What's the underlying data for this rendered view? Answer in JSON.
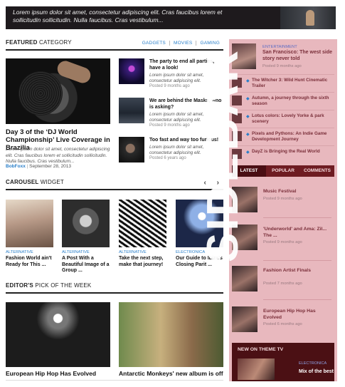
{
  "banner": {
    "text": "Lorem ipsum dolor sit amet, consectetur adipiscing elit. Cras faucibus lorem et sollicitudin sollicitudin. Nulla faucibus. Cras vestibulum..."
  },
  "featured": {
    "heading_bold": "FEATURED",
    "heading_light": "CATEGORY",
    "tabs": [
      "GADGETS",
      "MOVIES",
      "GAMING"
    ],
    "main": {
      "title": "Day 3 of the ‘DJ World Championship’ Live Coverage in Brazilia",
      "excerpt": "Lorem ipsum dolor sit amet, consectetur adipiscing elit. Cras faucibus lorem et sollicitudin sollicitudin. Nulla faucibus. Cras vestibulum...",
      "author": "BobFoxx",
      "date": "September 28, 2013"
    },
    "minis": [
      {
        "title": "The party to end all parties, have a look!",
        "excerpt": "Lorem ipsum dolor sit amet, consectetur adipiscing elit.",
        "date": "Posted 9 months ago"
      },
      {
        "title": "We are behind the Masks, who is asking?",
        "excerpt": "Lorem ipsum dolor sit amet, consectetur adipiscing elit.",
        "date": "Posted 9 months ago"
      },
      {
        "title": "Too fast and way too furious!",
        "excerpt": "Lorem ipsum dolor sit amet, consectetur adipiscing elit.",
        "date": "Posted 6 years ago"
      }
    ]
  },
  "carousel": {
    "heading_bold": "CAROUSEL",
    "heading_light": "WIDGET",
    "arrows": "‹ ›",
    "items": [
      {
        "cat": "ALTERNATIVE",
        "title": "Fashion World ain't Ready for This ..."
      },
      {
        "cat": "ALTERNATIVE",
        "title": "A Post With a Beautiful Image of a Group ..."
      },
      {
        "cat": "ALTERNATIVE",
        "title": "Take the next step, make that journey!"
      },
      {
        "cat": "ELECTRONICA",
        "title": "Our Guide to Ibiza's Closing Parit ..."
      }
    ]
  },
  "editors": {
    "heading_bold": "EDITOR'S",
    "heading_light": "PICK OF THE WEEK",
    "posts": [
      {
        "title": "European Hip Hop Has Evolved"
      },
      {
        "title": "Antarctic Monkeys' new album is off"
      }
    ]
  },
  "sidebar": {
    "overlay": "SIDEBAR",
    "top": {
      "cat": "ENTERTAINMENT",
      "title": "San Francisco: The west side story never told",
      "date": "Posted 9 months ago"
    },
    "list": [
      {
        "title": "The Witcher 3: Wild Hunt Cinematic Trailer"
      },
      {
        "title": "Autumn, a journey through the sixth season"
      },
      {
        "title": "Lotus colors: Lovely Yorke & park scenery"
      },
      {
        "title": "Pixels and Pythons: An Indie Game Development Journey"
      },
      {
        "title": "DayZ is Bringing the Real World"
      }
    ],
    "tabs": [
      "LATEST",
      "POPULAR",
      "COMMENTS"
    ],
    "posts": [
      {
        "title": "Music Festival",
        "date": "Posted 9 months ago"
      },
      {
        "title": "'Underworld' and Ama: Zil... The ...",
        "date": "Posted 9 months ago"
      },
      {
        "title": "Fashion Artist Finals",
        "date": "Posted 7 months ago"
      },
      {
        "title": "European Hip Hop Has Evolved",
        "date": "Posted 6 months ago"
      }
    ],
    "newon": {
      "heading": "NEW ON THEME TV",
      "cat": "ELECTRONICA",
      "title": "Mix of the best"
    }
  }
}
